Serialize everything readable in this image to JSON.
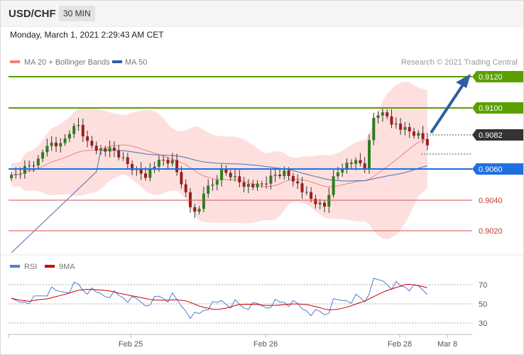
{
  "header": {
    "symbol": "USD/CHF",
    "timeframe": "30 MIN",
    "timestamp": "Monday, March 1, 2021 2:29:43 AM CET"
  },
  "legend": [
    {
      "label": "MA 20 + Bollinger Bands",
      "color": "#f08080"
    },
    {
      "label": "MA 50",
      "color": "#2f5fa0"
    }
  ],
  "credit": "Research © 2021 Trading Central",
  "rsi_legend": [
    {
      "label": "RSI",
      "color": "#4f7fd0"
    },
    {
      "label": "9MA",
      "color": "#cc0000"
    }
  ],
  "colors": {
    "up_candle": "#2e7d1f",
    "down_candle": "#a01c1c",
    "resistance": "#5aa000",
    "support": "#1f6fe0",
    "target": "#d94c4c",
    "arrow": "#2f5fa0",
    "band": "#fde0de"
  },
  "chart_data": {
    "type": "candlestick",
    "y_range": [
      9.0007,
      9.0176
    ],
    "x_labels": [
      "Feb 25",
      "Feb 26",
      "Feb 28",
      "Mar 8"
    ],
    "price_levels": [
      {
        "label": "0.9120",
        "kind": "resistance"
      },
      {
        "label": "0.9100",
        "kind": "resistance"
      },
      {
        "label": "0.9082",
        "kind": "current"
      },
      {
        "label": "0.9060",
        "kind": "support"
      },
      {
        "label": "0.9040",
        "kind": "target"
      },
      {
        "label": "0.9020",
        "kind": "target"
      }
    ],
    "rsi": {
      "range": [
        20,
        85
      ],
      "ticks": [
        "70",
        "50",
        "30"
      ]
    }
  }
}
